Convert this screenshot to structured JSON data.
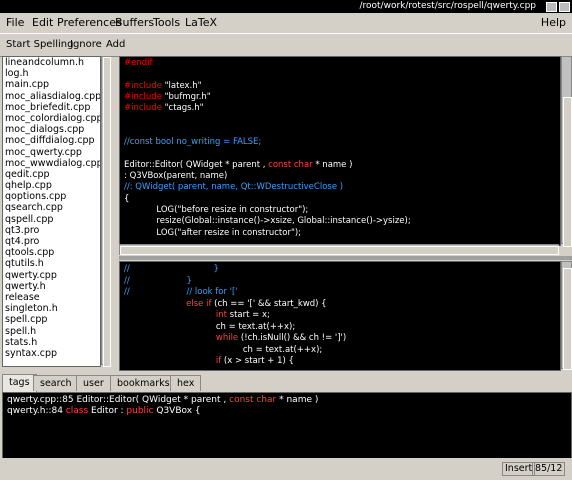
{
  "window": {
    "title": "/root/work/rotest/src/rospell/qwerty.cpp"
  },
  "menubar": [
    "File",
    "Edit",
    "Preferences",
    "Buffers",
    "Tools",
    "LaTeX"
  ],
  "help_menu": "Help",
  "toolbar": [
    "Start Spelling",
    "Ignore",
    "Add"
  ],
  "files": [
    "lineandcolumn.h",
    "log.h",
    "main.cpp",
    "moc_aliasdialog.cpp",
    "moc_briefedit.cpp",
    "moc_colordialog.cpp",
    "moc_dialogs.cpp",
    "moc_diffdialog.cpp",
    "moc_qwerty.cpp",
    "moc_wwwdialog.cpp",
    "qedit.cpp",
    "qhelp.cpp",
    "qoptions.cpp",
    "qsearch.cpp",
    "qspell.cpp",
    "qt3.pro",
    "qt4.pro",
    "qtools.cpp",
    "qtutils.h",
    "qwerty.cpp",
    "qwerty.h",
    "release",
    "singleton.h",
    "spell.cpp",
    "spell.h",
    "stats.h",
    "syntax.cpp"
  ],
  "editor_top": [
    {
      "parts": [
        {
          "t": "#endif",
          "c": "#ff0000"
        }
      ]
    },
    {
      "parts": [
        {
          "t": "",
          "c": "#fff"
        }
      ]
    },
    {
      "parts": [
        {
          "t": "#include ",
          "c": "#ff0000"
        },
        {
          "t": "\"latex.h\"",
          "c": "#ffffff"
        }
      ]
    },
    {
      "parts": [
        {
          "t": "#include ",
          "c": "#ff0000"
        },
        {
          "t": "\"bufmgr.h\"",
          "c": "#ffffff"
        }
      ]
    },
    {
      "parts": [
        {
          "t": "#include ",
          "c": "#ff0000"
        },
        {
          "t": "\"ctags.h\"",
          "c": "#ffffff"
        }
      ]
    },
    {
      "parts": [
        {
          "t": "",
          "c": "#fff"
        }
      ]
    },
    {
      "parts": [
        {
          "t": "",
          "c": "#fff"
        }
      ]
    },
    {
      "parts": [
        {
          "t": "//const bool no_writing = FALSE;",
          "c": "#3aa0ff"
        }
      ]
    },
    {
      "parts": [
        {
          "t": "",
          "c": "#fff"
        }
      ]
    },
    {
      "parts": [
        {
          "t": "Editor::Editor( QWidget * parent , ",
          "c": "#ffffff"
        },
        {
          "t": "const char",
          "c": "#ff4040"
        },
        {
          "t": " * name )",
          "c": "#ffffff"
        }
      ]
    },
    {
      "parts": [
        {
          "t": ": Q3VBox(parent, name)",
          "c": "#ffffff"
        }
      ]
    },
    {
      "parts": [
        {
          "t": "//: QWidget( parent, name, Qt::WDestructiveClose )",
          "c": "#3aa0ff"
        }
      ]
    },
    {
      "parts": [
        {
          "t": "{",
          "c": "#ffffff"
        }
      ]
    },
    {
      "parts": [
        {
          "t": "            LOG(\"before resize in constructor\");",
          "c": "#ffffff"
        }
      ]
    },
    {
      "parts": [
        {
          "t": "            resize(Global::instance()->xsize, Global::instance()->ysize);",
          "c": "#ffffff"
        }
      ]
    },
    {
      "parts": [
        {
          "t": "            LOG(\"after resize in constructor\");",
          "c": "#ffffff"
        }
      ]
    }
  ],
  "editor_bottom": [
    {
      "parts": [
        {
          "t": "//                               }",
          "c": "#3aa0ff"
        }
      ]
    },
    {
      "parts": [
        {
          "t": "//                     }",
          "c": "#3aa0ff"
        }
      ]
    },
    {
      "parts": [
        {
          "t": "//                     // look for '['",
          "c": "#3aa0ff"
        }
      ]
    },
    {
      "parts": [
        {
          "t": "                       ",
          "c": "#fff"
        },
        {
          "t": "else if",
          "c": "#ff4040"
        },
        {
          "t": " (ch == '[' && start_kwd) {",
          "c": "#ffffff"
        }
      ]
    },
    {
      "parts": [
        {
          "t": "                                  ",
          "c": "#fff"
        },
        {
          "t": "int",
          "c": "#ff4040"
        },
        {
          "t": " start = x;",
          "c": "#ffffff"
        }
      ]
    },
    {
      "parts": [
        {
          "t": "                                  ch = text.at(++x);",
          "c": "#ffffff"
        }
      ]
    },
    {
      "parts": [
        {
          "t": "                                  ",
          "c": "#fff"
        },
        {
          "t": "while",
          "c": "#ff4040"
        },
        {
          "t": " (!ch.isNull() && ch != ']')",
          "c": "#ffffff"
        }
      ]
    },
    {
      "parts": [
        {
          "t": "                                            ch = text.at(++x);",
          "c": "#ffffff"
        }
      ]
    },
    {
      "parts": [
        {
          "t": "                                  ",
          "c": "#fff"
        },
        {
          "t": "if",
          "c": "#ff4040"
        },
        {
          "t": " (x > start + 1) {",
          "c": "#ffffff"
        }
      ]
    }
  ],
  "tabs": [
    "tags",
    "search",
    "user",
    "bookmarks",
    "hex"
  ],
  "output": [
    {
      "parts": [
        {
          "t": "qwerty.cpp::85 Editor::Editor( QWidget * parent , ",
          "c": "#ffffff"
        },
        {
          "t": "const char",
          "c": "#ff4040"
        },
        {
          "t": " * name )",
          "c": "#ffffff"
        }
      ]
    },
    {
      "parts": [
        {
          "t": "qwerty.h::84 ",
          "c": "#ffffff"
        },
        {
          "t": "class",
          "c": "#ff4040"
        },
        {
          "t": " Editor : ",
          "c": "#ffffff"
        },
        {
          "t": "public",
          "c": "#ff4040"
        },
        {
          "t": " Q3VBox {",
          "c": "#ffffff"
        }
      ]
    }
  ],
  "status": {
    "mode": "Insert",
    "position": "85/12"
  }
}
